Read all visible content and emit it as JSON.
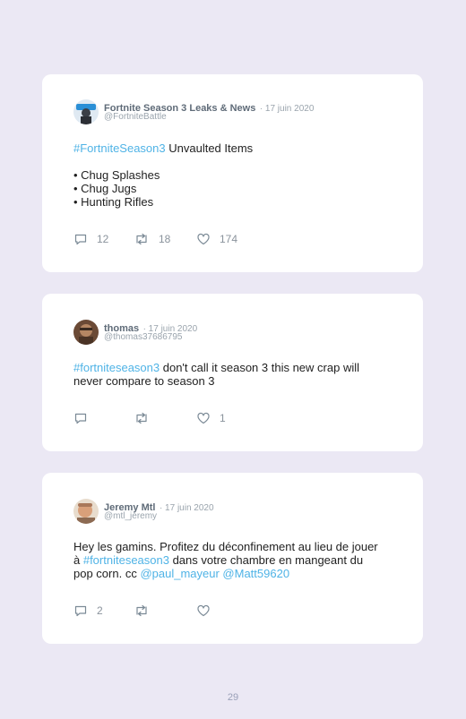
{
  "tweets": [
    {
      "name": "Fortnite Season 3 Leaks & News",
      "date": "· 17 juin 2020",
      "handle": "@FortniteBattle",
      "avatar": "fortnite-avatar",
      "lines": [
        [
          {
            "t": "#FortniteSeason3",
            "link": true
          },
          {
            "t": " Unvaulted Items",
            "link": false
          }
        ],
        [],
        [
          {
            "t": "• Chug Splashes",
            "link": false
          }
        ],
        [
          {
            "t": "• Chug Jugs",
            "link": false
          }
        ],
        [
          {
            "t": "• Hunting Rifles",
            "link": false
          }
        ]
      ],
      "replies": "12",
      "retweets": "18",
      "likes": "174"
    },
    {
      "name": "thomas",
      "date": "· 17 juin 2020",
      "handle": "@thomas37686795",
      "avatar": "thomas-avatar",
      "lines": [
        [
          {
            "t": "#fortniteseason3",
            "link": true
          },
          {
            "t": " don't call it season 3 this new crap will",
            "link": false
          }
        ],
        [
          {
            "t": "never compare to season 3",
            "link": false
          }
        ]
      ],
      "replies": "",
      "retweets": "",
      "likes": "1"
    },
    {
      "name": "Jeremy Mtl",
      "date": "· 17 juin 2020",
      "handle": "@mtl_jeremy",
      "avatar": "jeremy-avatar",
      "lines": [
        [
          {
            "t": "Hey les gamins. Profitez du déconfinement au lieu de jouer",
            "link": false
          }
        ],
        [
          {
            "t": "à ",
            "link": false
          },
          {
            "t": "#fortniteseason3",
            "link": true
          },
          {
            "t": " dans votre chambre en mangeant du",
            "link": false
          }
        ],
        [
          {
            "t": "pop corn. cc ",
            "link": false
          },
          {
            "t": "@paul_mayeur",
            "link": true
          },
          {
            "t": " ",
            "link": false
          },
          {
            "t": "@Matt59620",
            "link": true
          }
        ]
      ],
      "replies": "2",
      "retweets": "",
      "likes": ""
    }
  ],
  "page_number": "29",
  "colors": {
    "background": "#ebe8f4",
    "card": "#ffffff",
    "link": "#4fb3e6",
    "meta": "#9aa4ad"
  }
}
